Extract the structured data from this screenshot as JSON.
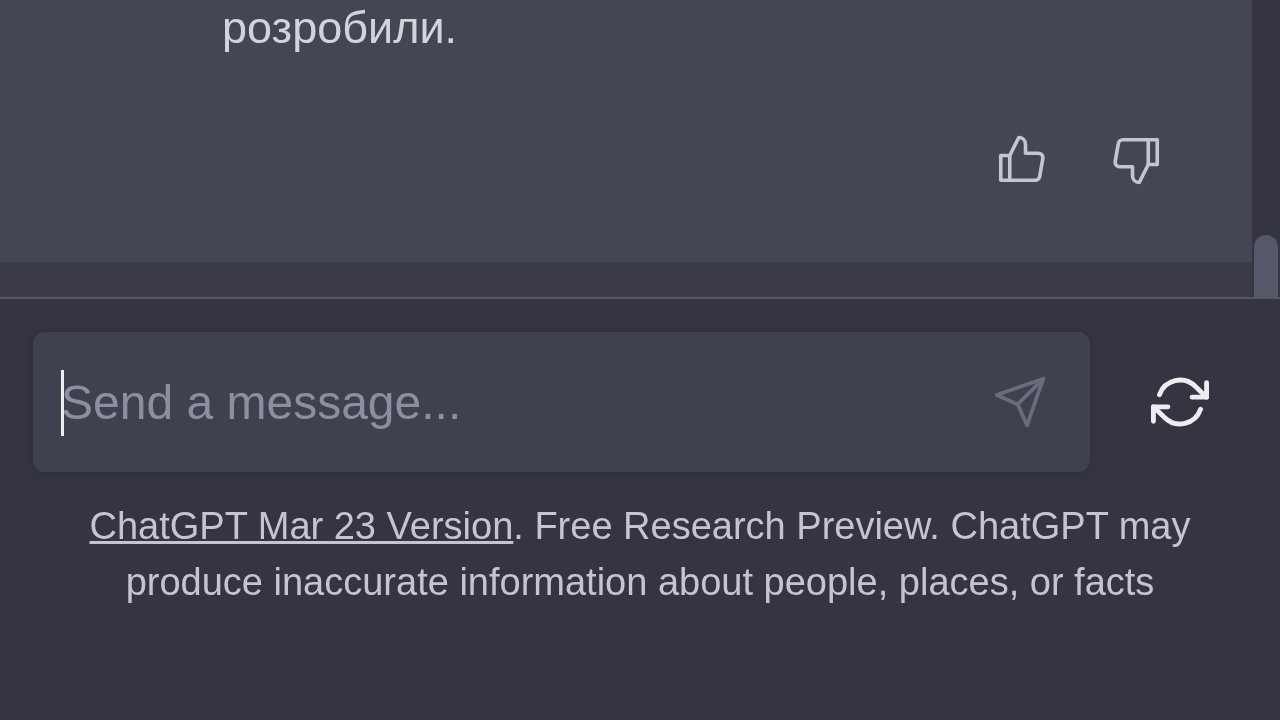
{
  "message": {
    "text": "розробили."
  },
  "composer": {
    "placeholder": "Send a message...",
    "focused": true
  },
  "footer": {
    "link": "ChatGPT Mar 23 Version",
    "text": ". Free Research Preview. ChatGPT may produce inaccurate information about people, places, or facts"
  }
}
